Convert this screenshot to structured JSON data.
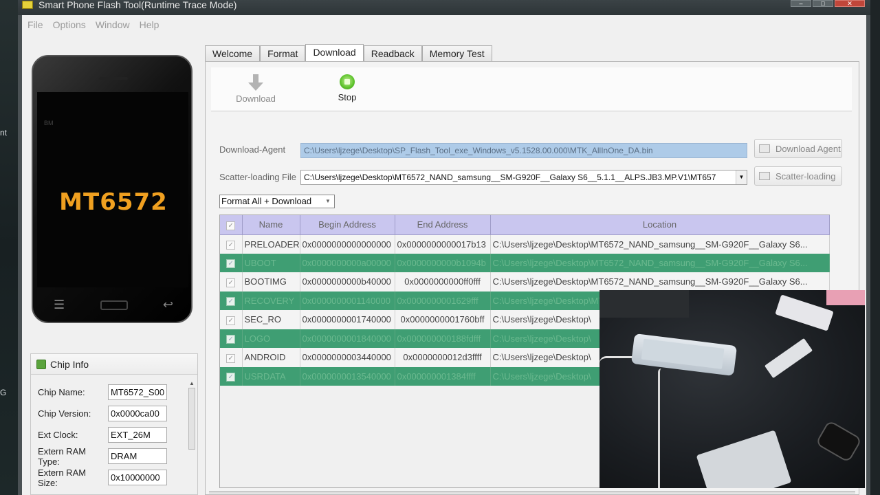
{
  "desktop": {
    "left_texts": [
      "nt",
      "G"
    ]
  },
  "window": {
    "title": "Smart Phone Flash Tool(Runtime Trace Mode)",
    "controls": [
      "–",
      "□",
      "✕"
    ]
  },
  "menu": [
    "File",
    "Options",
    "Window",
    "Help"
  ],
  "phone": {
    "chip_label": "MT6572",
    "brand": "BM"
  },
  "chip_info": {
    "title": "Chip Info",
    "rows": [
      {
        "key": "Chip Name:",
        "value": "MT6572_S00"
      },
      {
        "key": "Chip Version:",
        "value": "0x0000ca00"
      },
      {
        "key": "Ext Clock:",
        "value": "EXT_26M"
      },
      {
        "key": "Extern RAM Type:",
        "value": "DRAM"
      },
      {
        "key": "Extern RAM Size:",
        "value": "0x10000000"
      }
    ]
  },
  "tabs": [
    "Welcome",
    "Format",
    "Download",
    "Readback",
    "Memory Test"
  ],
  "active_tab": "Download",
  "toolbar": {
    "download_label": "Download",
    "stop_label": "Stop"
  },
  "download_agent": {
    "label": "Download-Agent",
    "value": "C:\\Users\\ljzege\\Desktop\\SP_Flash_Tool_exe_Windows_v5.1528.00.000\\MTK_AllInOne_DA.bin",
    "button": "Download Agent"
  },
  "scatter": {
    "label": "Scatter-loading File",
    "value": "C:\\Users\\ljzege\\Desktop\\MT6572_NAND_samsung__SM-G920F__Galaxy S6__5.1.1__ALPS.JB3.MP.V1\\MT657",
    "button": "Scatter-loading"
  },
  "mode": "Format All + Download",
  "table": {
    "columns": [
      "Name",
      "Begin Address",
      "End Address",
      "Location"
    ],
    "rows": [
      {
        "name": "PRELOADER",
        "begin": "0x0000000000000000",
        "end": "0x0000000000017b13",
        "location": "C:\\Users\\ljzege\\Desktop\\MT6572_NAND_samsung__SM-G920F__Galaxy S6..."
      },
      {
        "name": "UBOOT",
        "begin": "0x0000000000a00000",
        "end": "0x0000000000b1094b",
        "location": "C:\\Users\\ljzege\\Desktop\\MT6572_NAND_samsung__SM-G920F__Galaxy S6..."
      },
      {
        "name": "BOOTIMG",
        "begin": "0x0000000000b40000",
        "end": "0x0000000000ff0fff",
        "location": "C:\\Users\\ljzege\\Desktop\\MT6572_NAND_samsung__SM-G920F__Galaxy S6..."
      },
      {
        "name": "RECOVERY",
        "begin": "0x0000000001140000",
        "end": "0x0000000001629fff",
        "location": "C:\\Users\\ljzege\\Desktop\\MT6572_NAND_samsung__SM-G920F__Galaxy S6..."
      },
      {
        "name": "SEC_RO",
        "begin": "0x0000000001740000",
        "end": "0x0000000001760bff",
        "location": "C:\\Users\\ljzege\\Desktop\\"
      },
      {
        "name": "LOGO",
        "begin": "0x0000000001840000",
        "end": "0x000000000188fdfff",
        "location": "C:\\Users\\ljzege\\Desktop\\"
      },
      {
        "name": "ANDROID",
        "begin": "0x0000000003440000",
        "end": "0x0000000012d3ffff",
        "location": "C:\\Users\\ljzege\\Desktop\\"
      },
      {
        "name": "USRDATA",
        "begin": "0x0000000013540000",
        "end": "0x000000001384ffff",
        "location": "C:\\Users\\ljzege\\Desktop\\"
      }
    ]
  }
}
